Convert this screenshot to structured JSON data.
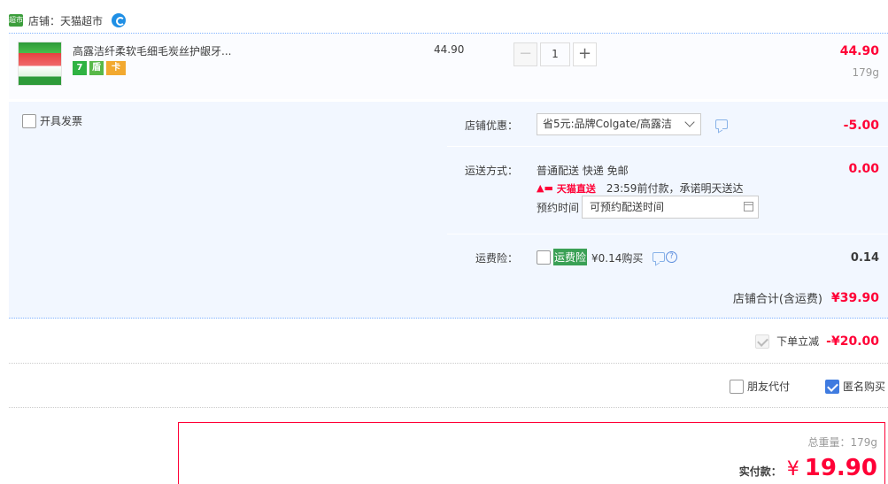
{
  "shop": {
    "logo_text": "超市",
    "name": "店铺：天猫超市"
  },
  "item": {
    "title": "高露洁纤柔软毛细毛炭丝护龈牙...",
    "badges": [
      "7",
      "盾",
      "卡"
    ],
    "unit_price": "44.90",
    "quantity": "1",
    "minus_label": "−",
    "plus_label": "+",
    "total": "44.90",
    "weight": "179g"
  },
  "invoice": {
    "label": "开具发票"
  },
  "discount": {
    "label": "店铺优惠：",
    "selected": "省5元:品牌Colgate/高露洁",
    "amount": "-5.00"
  },
  "delivery": {
    "label": "运送方式：",
    "method": "普通配送 快递 免邮",
    "tmall_tag": "天猫直送",
    "promise": "23:59前付款，承诺明天送达",
    "schedule_label": "预约时间",
    "schedule_placeholder": "可预约配送时间",
    "amount": "0.00"
  },
  "insurance": {
    "label": "运费险：",
    "tag": "运费险",
    "price": "¥0.14购买",
    "amount": "0.14"
  },
  "shop_total": {
    "label": "店铺合计(含运费)",
    "amount": "¥39.90"
  },
  "instant_discount": {
    "label": "下单立减",
    "amount": "-¥20.00"
  },
  "pay_options": {
    "friend_pay": "朋友代付",
    "anonymous": "匿名购买"
  },
  "final": {
    "weight_label": "总重量：",
    "weight": "179g",
    "pay_label": "实付款：",
    "currency": "¥",
    "amount": "19.90"
  },
  "colors": {
    "accent_red": "#ff0036",
    "option_bg": "#f2f7ff",
    "check_blue": "#3f7be0"
  }
}
